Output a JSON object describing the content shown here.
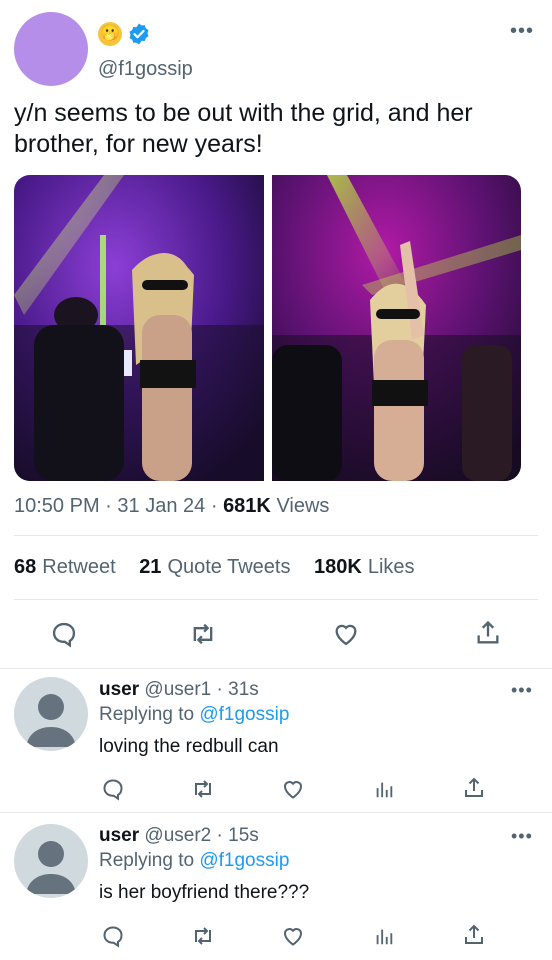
{
  "tweet": {
    "handle": "@f1gossip",
    "emoji": "🫢",
    "text": "y/n seems to be out with the grid, and her brother, for new years!",
    "time": "10:50 PM",
    "date": "31 Jan 24",
    "views_count": "681K",
    "views_label": "Views",
    "retweets_count": "68",
    "retweets_label": "Retweet",
    "quotes_count": "21",
    "quotes_label": "Quote Tweets",
    "likes_count": "180K",
    "likes_label": "Likes",
    "sep": "·"
  },
  "icons": {
    "reply": "reply-icon",
    "retweet": "retweet-icon",
    "like": "heart-icon",
    "share": "share-icon",
    "views": "analytics-icon",
    "more": "more-icon",
    "verified": "verified-badge-icon"
  },
  "colors": {
    "accent": "#1d9bf0",
    "secondary_text": "#536471",
    "avatar_main": "#b48ee8",
    "reply_avatar": "#cfd9de"
  },
  "replies": [
    {
      "name": "user",
      "handle": "@user1",
      "sep": "·",
      "time": "31s",
      "replying_label": "Replying to",
      "replying_to": "@f1gossip",
      "text": "loving the redbull can"
    },
    {
      "name": "user",
      "handle": "@user2",
      "sep": "·",
      "time": "15s",
      "replying_label": "Replying to",
      "replying_to": "@f1gossip",
      "text": "is her boyfriend there???"
    }
  ],
  "more_glyph": "•••"
}
